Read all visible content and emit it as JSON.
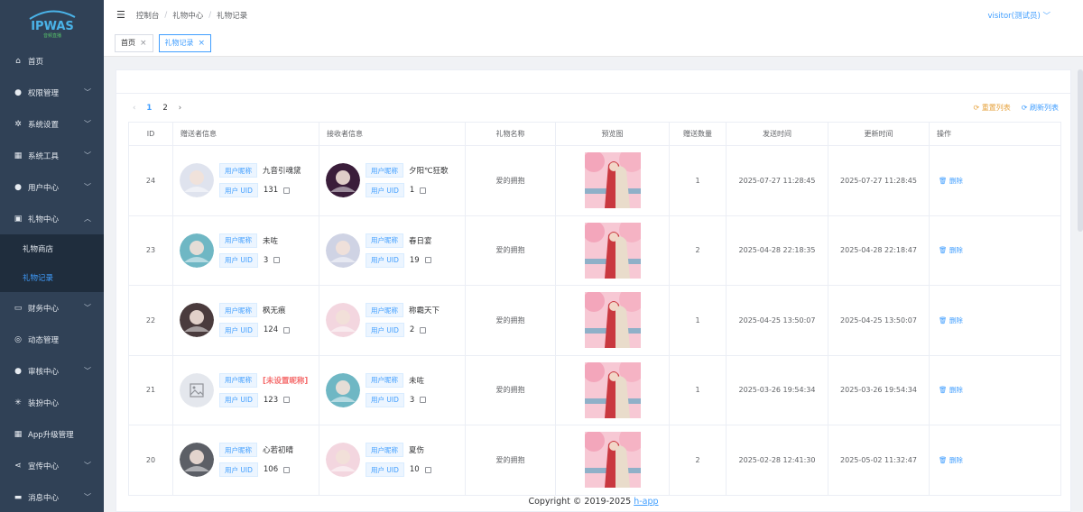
{
  "logo": {
    "text": "IPWAS",
    "sub": "音频直播"
  },
  "sidebar": {
    "items": [
      {
        "name": "home",
        "icon": "home-icon",
        "glyph": "⌂",
        "label": "首页",
        "chev": false
      },
      {
        "name": "perm",
        "icon": "user-icon",
        "glyph": "●",
        "label": "权限管理",
        "chev": true
      },
      {
        "name": "settings",
        "icon": "gear-icon",
        "glyph": "✲",
        "label": "系统设置",
        "chev": true
      },
      {
        "name": "tools",
        "icon": "grid-icon",
        "glyph": "▦",
        "label": "系统工具",
        "chev": true
      },
      {
        "name": "usercenter",
        "icon": "user-icon",
        "glyph": "●",
        "label": "用户中心",
        "chev": true
      },
      {
        "name": "gift",
        "icon": "gift-icon",
        "glyph": "▣",
        "label": "礼物中心",
        "chev": true,
        "open": true
      }
    ],
    "sub": [
      {
        "label": "礼物商店"
      },
      {
        "label": "礼物记录",
        "active": true
      }
    ],
    "items2": [
      {
        "name": "finance",
        "icon": "folder-icon",
        "glyph": "▭",
        "label": "财务中心",
        "chev": true
      },
      {
        "name": "dynamic",
        "icon": "compass-icon",
        "glyph": "◎",
        "label": "动态管理",
        "chev": false
      },
      {
        "name": "review",
        "icon": "user-icon",
        "glyph": "●",
        "label": "审核中心",
        "chev": true
      },
      {
        "name": "dress",
        "icon": "sparkle-icon",
        "glyph": "✳",
        "label": "装扮中心",
        "chev": false
      },
      {
        "name": "appupgrade",
        "icon": "grid-icon",
        "glyph": "▦",
        "label": "App升级管理",
        "chev": false
      },
      {
        "name": "promo",
        "icon": "share-icon",
        "glyph": "⋖",
        "label": "宣传中心",
        "chev": true
      },
      {
        "name": "msg",
        "icon": "message-icon",
        "glyph": "▬",
        "label": "消息中心",
        "chev": true
      }
    ]
  },
  "header": {
    "breadcrumb": [
      "控制台",
      "礼物中心",
      "礼物记录"
    ],
    "user": "visitor(测试员)"
  },
  "tags": [
    {
      "label": "首页",
      "active": false
    },
    {
      "label": "礼物记录",
      "active": true
    }
  ],
  "pager": {
    "pages": [
      "1",
      "2"
    ]
  },
  "actions": {
    "reset": "重置列表",
    "refresh": "刷新列表"
  },
  "table": {
    "headers": [
      "ID",
      "赠送者信息",
      "接收者信息",
      "礼物名称",
      "预览图",
      "赠送数量",
      "发送时间",
      "更新时间",
      "操作"
    ],
    "nickname_label": "用户昵称",
    "uid_label": "用户 UID",
    "delete_label": "删除",
    "rows": [
      {
        "id": "24",
        "sender": {
          "nick": "九音引魂黛",
          "uid": "131",
          "avatar": "#dfe3ee"
        },
        "receiver": {
          "nick": "夕阳℃狂歌",
          "uid": "1",
          "avatar": "#3a1d3a"
        },
        "gift": "爱的拥抱",
        "qty": "1",
        "sent": "2025-07-27 11:28:45",
        "updated": "2025-07-27 11:28:45"
      },
      {
        "id": "23",
        "sender": {
          "nick": "未咗",
          "uid": "3",
          "avatar": "#6fb7c4"
        },
        "receiver": {
          "nick": "春日宴",
          "uid": "19",
          "avatar": "#cfd3e4"
        },
        "gift": "爱的拥抱",
        "qty": "2",
        "sent": "2025-04-28 22:18:35",
        "updated": "2025-04-28 22:18:47"
      },
      {
        "id": "22",
        "sender": {
          "nick": "枫无痕",
          "uid": "124",
          "avatar": "#4a3b3d"
        },
        "receiver": {
          "nick": "称霸天下",
          "uid": "2",
          "avatar": "#f3d6df"
        },
        "gift": "爱的拥抱",
        "qty": "1",
        "sent": "2025-04-25 13:50:07",
        "updated": "2025-04-25 13:50:07"
      },
      {
        "id": "21",
        "sender": {
          "nick": "[未设置昵称]",
          "uid": "123",
          "avatar": "#e4e7ed",
          "warn": true
        },
        "receiver": {
          "nick": "未咗",
          "uid": "3",
          "avatar": "#6fb7c4"
        },
        "gift": "爱的拥抱",
        "qty": "1",
        "sent": "2025-03-26 19:54:34",
        "updated": "2025-03-26 19:54:34"
      },
      {
        "id": "20",
        "sender": {
          "nick": "心若初晴",
          "uid": "106",
          "avatar": "#5c5f66"
        },
        "receiver": {
          "nick": "夏伤",
          "uid": "10",
          "avatar": "#f3d6df"
        },
        "gift": "爱的拥抱",
        "qty": "2",
        "sent": "2025-02-28 12:41:30",
        "updated": "2025-05-02 11:32:47"
      }
    ]
  },
  "footer": {
    "text": "Copyright © 2019-2025 ",
    "link": "h-app"
  }
}
